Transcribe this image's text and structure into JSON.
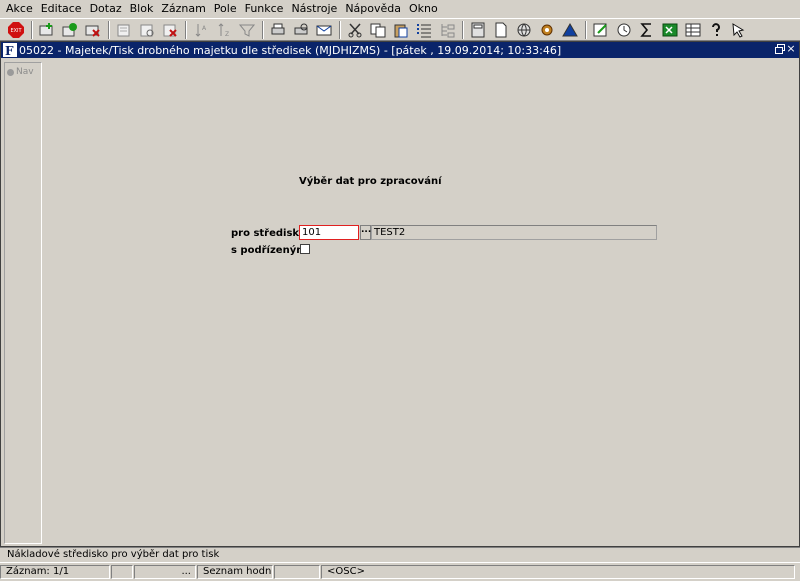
{
  "menu": [
    {
      "label": "Akce"
    },
    {
      "label": "Editace"
    },
    {
      "label": "Dotaz"
    },
    {
      "label": "Blok"
    },
    {
      "label": "Záznam"
    },
    {
      "label": "Pole"
    },
    {
      "label": "Funkce"
    },
    {
      "label": "Nástroje"
    },
    {
      "label": "Nápověda"
    },
    {
      "label": "Okno"
    }
  ],
  "toolbar": {
    "exit_label": "EXIT"
  },
  "window": {
    "title": "05022 - Majetek/Tisk drobného majetku dle středisek (MJDHIZMS) - [pátek  , 19.09.2014; 10:33:46]",
    "app_icon": "F"
  },
  "nav": {
    "label": "Nav"
  },
  "form": {
    "title": "Výběr dat pro zpracování",
    "stredisko_label": "pro středisko",
    "stredisko_value": "101",
    "lov_label": "...",
    "stredisko_name": "TEST2",
    "podrizenymi_label": "s podřízenými",
    "podrizenymi_checked": false
  },
  "hint": "Nákladové středisko pro výběr dat pro tisk",
  "status": {
    "record": "Záznam: 1/1",
    "cell2": "",
    "cell3": "...",
    "list": "Seznam hodn...",
    "cell5": "",
    "mode": "<OSC>"
  },
  "colors": {
    "titlebar": "#0a246a",
    "background": "#d4d0c8",
    "focus_border": "#e02020"
  }
}
